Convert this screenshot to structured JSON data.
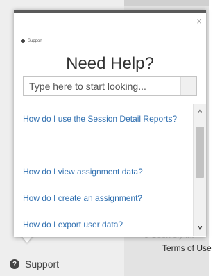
{
  "popup": {
    "brand_label": "Support",
    "title": "Need Help?",
    "close_label": "×",
    "search": {
      "placeholder": "Type here to start looking...",
      "value": ""
    },
    "results": [
      {
        "label": "How do I use the Session Detail Reports?"
      },
      {
        "label": "How do I view assignment data?"
      },
      {
        "label": "How do I create an assignment?"
      },
      {
        "label": "How do I export user data?"
      }
    ],
    "scroll": {
      "up_label": "^",
      "down_label": "v"
    }
  },
  "footer": {
    "support_label": "Support",
    "support_icon_glyph": "?",
    "support_icon": "question-circle-icon",
    "terms_link": "Terms of Use",
    "background_fragment": "ɑ Soon sly inl"
  },
  "colors": {
    "link": "#2f6fb0",
    "popup_top_bar": "#5a5a5a",
    "sidebar_bg": "#eeeeee"
  }
}
